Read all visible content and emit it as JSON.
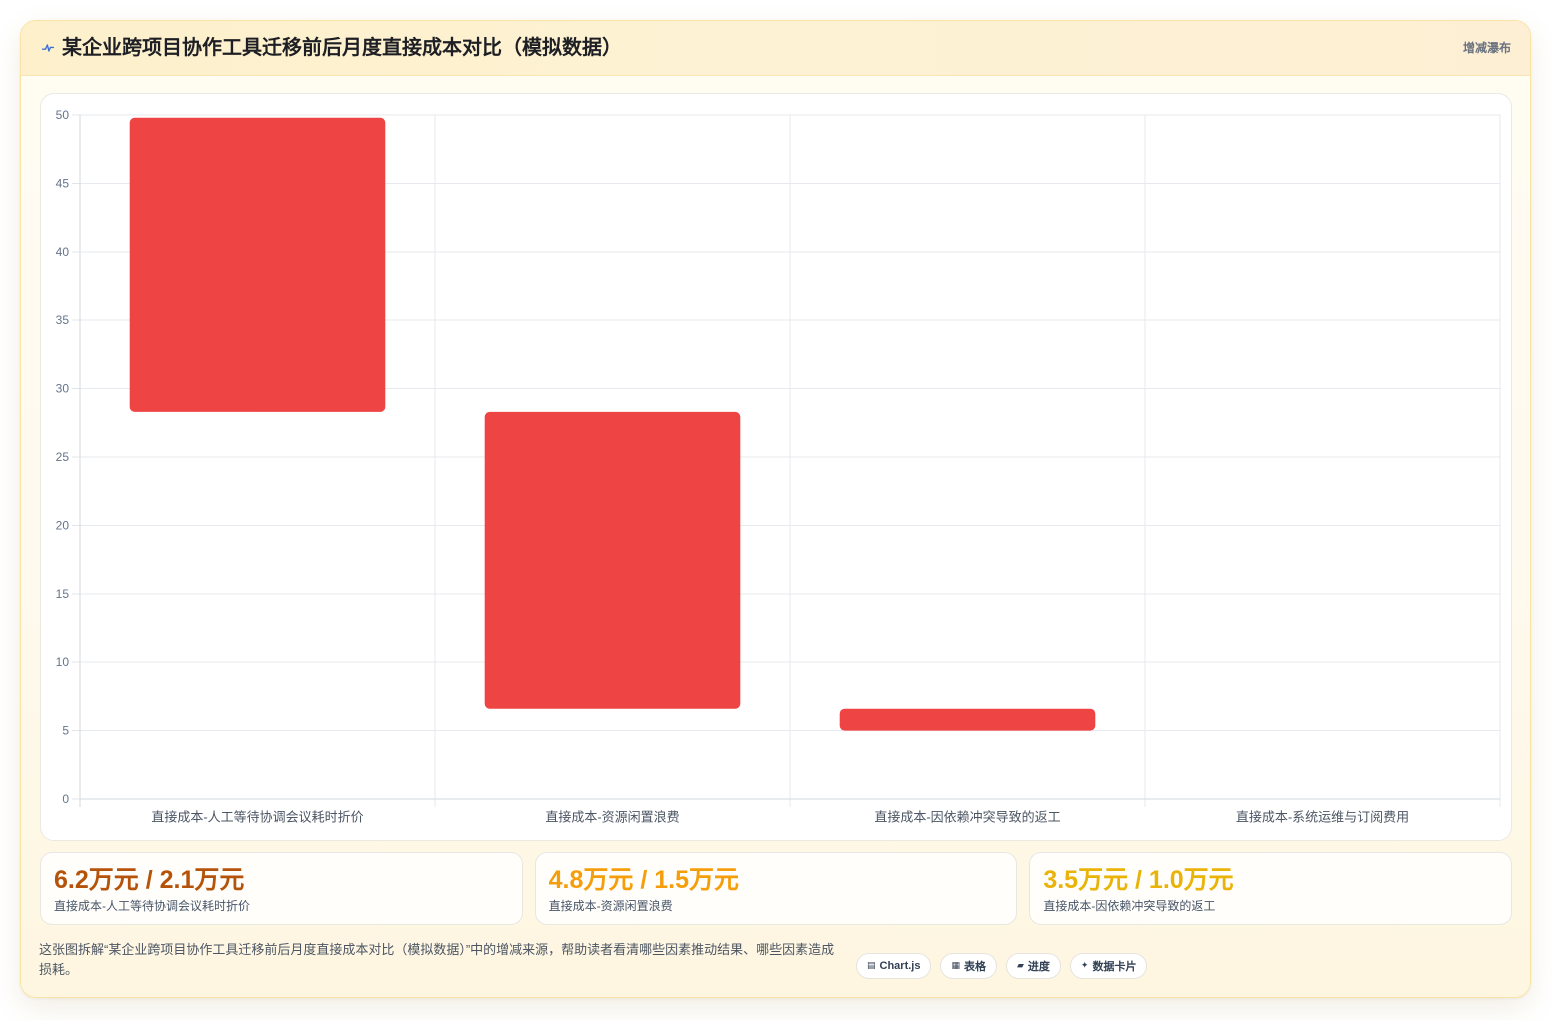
{
  "header": {
    "icon": "pulse-icon",
    "tag": "增减瀑布"
  },
  "chart_data": {
    "type": "bar",
    "variant": "waterfall",
    "title": "某企业跨项目协作工具迁移前后月度直接成本对比（模拟数据）",
    "categories": [
      "直接成本-人工等待协调会议耗时折价",
      "直接成本-资源闲置浪费",
      "直接成本-因依赖冲突导致的返工",
      "直接成本-系统运维与订阅费用"
    ],
    "series": [
      {
        "color": "#ef4444",
        "values": [
          [
            28.3,
            49.8
          ],
          [
            6.6,
            28.3
          ],
          [
            5.0,
            6.6
          ],
          null
        ]
      }
    ],
    "ylim": [
      0,
      50
    ],
    "yticks": [
      0,
      5,
      10,
      15,
      20,
      25,
      30,
      35,
      40,
      45,
      50
    ],
    "grid": true,
    "legend": "none"
  },
  "stats": [
    {
      "value": "6.2万元 / 2.1万元",
      "label": "直接成本-人工等待协调会议耗时折价",
      "color": "#b45309"
    },
    {
      "value": "4.8万元 / 1.5万元",
      "label": "直接成本-资源闲置浪费",
      "color": "#f59e0b"
    },
    {
      "value": "3.5万元 / 1.0万元",
      "label": "直接成本-因依赖冲突导致的返工",
      "color": "#eab308"
    }
  ],
  "footer": {
    "description": "这张图拆解“某企业跨项目协作工具迁移前后月度直接成本对比（模拟数据）”中的增减来源，帮助读者看清哪些因素推动结果、哪些因素造成损耗。",
    "chips": [
      {
        "icon": "chart-icon",
        "label": "Chart.js"
      },
      {
        "icon": "table-icon",
        "label": "表格"
      },
      {
        "icon": "progress-icon",
        "label": "进度"
      },
      {
        "icon": "sparkle-icon",
        "label": "数据卡片"
      }
    ]
  }
}
